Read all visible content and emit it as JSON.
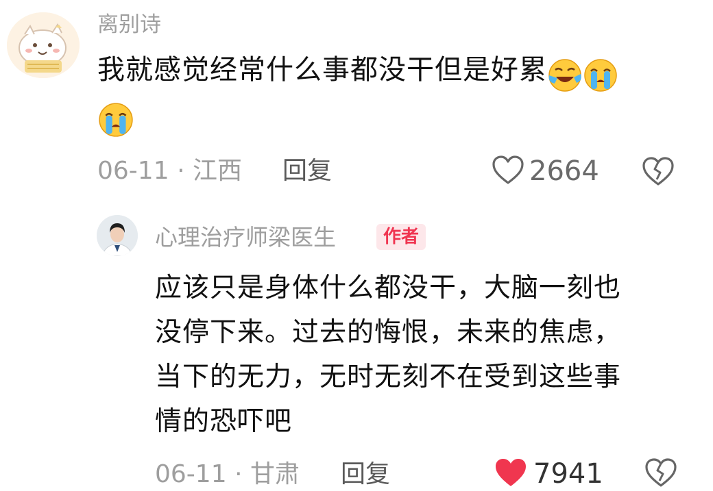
{
  "comment": {
    "username": "离别诗",
    "text": "我就感觉经常什么事都没干但是好累",
    "emojis": [
      "laughing-crying-emoji",
      "crying-emoji",
      "crying-emoji"
    ],
    "date": "06-11",
    "separator": "·",
    "location": "江西",
    "reply_label": "回复",
    "likes": "2664"
  },
  "reply": {
    "username": "心理治疗师梁医生",
    "badge": "作者",
    "text": "应该只是身体什么都没干，大脑一刻也\n没停下来。过去的悔恨，未来的焦虑，\n当下的无力，无时无刻不在受到这些事\n情的恐吓吧",
    "date": "06-11",
    "separator": "·",
    "location": "甘肃",
    "reply_label": "回复",
    "likes": "7941"
  },
  "colors": {
    "secondary_text": "#9e9e9e",
    "badge_bg": "#fde7ea",
    "badge_text": "#f03450",
    "liked_heart": "#f0364f",
    "icon_stroke": "#666666"
  }
}
